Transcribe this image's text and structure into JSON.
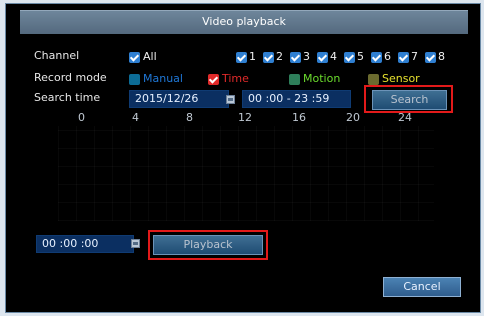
{
  "window": {
    "title": "Video playback"
  },
  "channel": {
    "label": "Channel",
    "all": {
      "label": "All",
      "checked": true
    },
    "items": [
      {
        "label": "1",
        "checked": true
      },
      {
        "label": "2",
        "checked": true
      },
      {
        "label": "3",
        "checked": true
      },
      {
        "label": "4",
        "checked": true
      },
      {
        "label": "5",
        "checked": true
      },
      {
        "label": "6",
        "checked": true
      },
      {
        "label": "7",
        "checked": true
      },
      {
        "label": "8",
        "checked": true
      }
    ]
  },
  "record_mode": {
    "label": "Record mode",
    "options": [
      {
        "label": "Manual",
        "checked": false,
        "color": "#1f77d6"
      },
      {
        "label": "Time",
        "checked": true,
        "color": "#e02a2a"
      },
      {
        "label": "Motion",
        "checked": false,
        "color": "#6bdc2d"
      },
      {
        "label": "Sensor",
        "checked": false,
        "color": "#e5e02e"
      }
    ]
  },
  "search_time": {
    "label": "Search time",
    "date": "2015/12/26",
    "time_range": "00 :00 - 23 :59"
  },
  "timeline": {
    "ticks": [
      "0",
      "4",
      "8",
      "12",
      "16",
      "20",
      "24"
    ]
  },
  "playback_time": {
    "value": "00 :00 :00"
  },
  "buttons": {
    "search": "Search",
    "playback": "Playback",
    "cancel": "Cancel"
  }
}
